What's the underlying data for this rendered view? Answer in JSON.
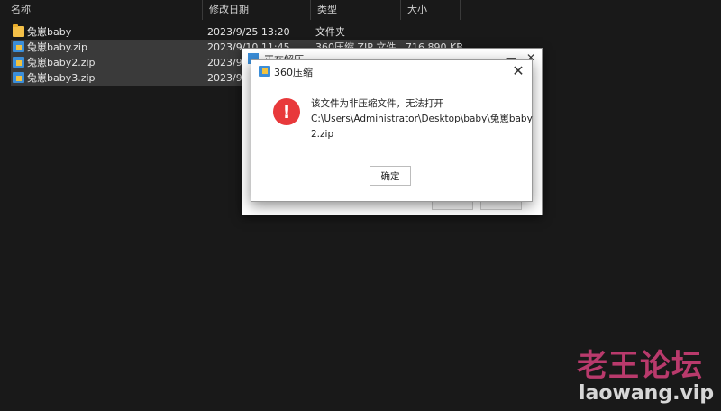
{
  "explorer": {
    "columns": {
      "name": "名称",
      "modified": "修改日期",
      "type": "类型",
      "size": "大小"
    },
    "files": [
      {
        "name": "兔崽baby",
        "modified": "2023/9/25 13:20",
        "type": "文件夹",
        "size": "",
        "icon": "folder-icon",
        "selected": false
      },
      {
        "name": "兔崽baby.zip",
        "modified": "2023/9/10 11:45",
        "type": "360压缩 ZIP 文件",
        "size": "716,890 KB",
        "icon": "zip-archive-icon",
        "selected": true
      },
      {
        "name": "兔崽baby2.zip",
        "modified": "2023/9/",
        "type": "",
        "size": "",
        "icon": "zip-archive-icon",
        "selected": true
      },
      {
        "name": "兔崽baby3.zip",
        "modified": "2023/9/",
        "type": "",
        "size": "",
        "icon": "zip-archive-icon",
        "selected": true
      }
    ]
  },
  "progress_window": {
    "title": "正在解压",
    "min_glyph": "—",
    "close_glyph": "✕"
  },
  "dialog": {
    "title": "360压缩",
    "close_glyph": "✕",
    "error_glyph": "!",
    "message_lines": [
      "该文件为非压缩文件，无法打开",
      "C:\\Users\\Administrator\\Desktop\\baby\\兔崽baby",
      "2.zip"
    ],
    "ok_label": "确定"
  },
  "watermark": {
    "cn": "老王论坛",
    "en": "laowang.vip"
  },
  "colors": {
    "background": "#191919",
    "selection": "#3a3a3a",
    "error_red": "#e8393b",
    "watermark_pink": "#b93a6c"
  }
}
